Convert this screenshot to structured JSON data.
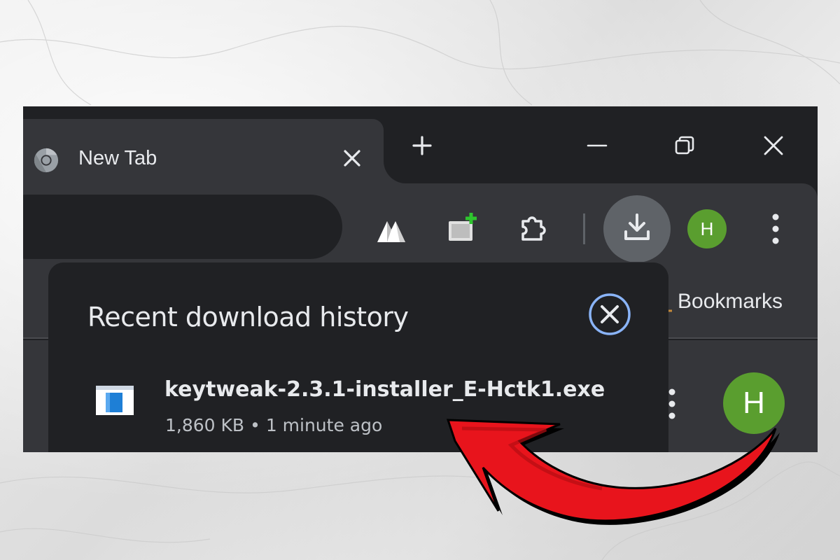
{
  "tab": {
    "title": "New Tab",
    "icon": "chrome-icon"
  },
  "window_controls": [
    "minimize-icon",
    "restore-icon",
    "close-icon"
  ],
  "toolbar": {
    "icons": [
      "mountain-extension-icon",
      "add-screenshot-extension-icon",
      "puzzle-extensions-icon",
      "download-icon",
      "more-vert-icon"
    ],
    "profile_initial": "H"
  },
  "bookmarks": {
    "label": "Bookmarks"
  },
  "downloads_panel": {
    "title": "Recent download history",
    "items": [
      {
        "file_name": "keytweak-2.3.1-installer_E-Hctk1.exe",
        "size": "1,860 KB",
        "separator": "•",
        "time": "1 minute ago"
      }
    ]
  },
  "page": {
    "avatar_initial": "H"
  },
  "colors": {
    "browser_dark": "#202124",
    "toolbar": "#35363a",
    "text": "#e8eaed",
    "avatar": "#5a9e2f",
    "close_ring": "#8ab4f8",
    "annotation_arrow": "#e8141c"
  }
}
